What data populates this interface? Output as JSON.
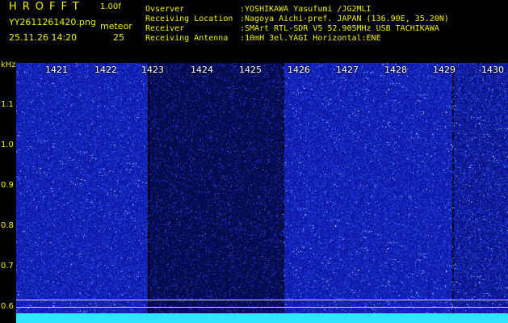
{
  "header": {
    "app_title": "HROFFT",
    "version": "1.00f",
    "filename": "YY2611261420.png",
    "timestamp": "25.11.26 14:20",
    "detection_label": "meteor",
    "detection_count": "25"
  },
  "station": [
    {
      "label": "Ovserver",
      "value": ":YOSHIKAWA Yasufumi /JG2MLI"
    },
    {
      "label": "Receiving Location",
      "value": ":Nagoya Aichi-pref. JAPAN (136.90E, 35.20N)"
    },
    {
      "label": "Receiver",
      "value": ":SMArt RTL-SDR V5 52.905MHz USB TACHIKAWA"
    },
    {
      "label": "Receiving Antenna",
      "value": ":10mH 3el.YAGI Horizontal:ENE"
    }
  ],
  "axis": {
    "unit": "kHz",
    "y_ticks": [
      "1.1",
      "1.0",
      "0.9",
      "0.8",
      "0.7",
      "0.6"
    ],
    "x_ticks": [
      "1421",
      "1422",
      "1423",
      "1424",
      "1425",
      "1426",
      "1427",
      "1428",
      "1429",
      "1430"
    ]
  },
  "colors": {
    "background": "#000000",
    "text": "#f0f000",
    "noise_base": "#0e1aa8",
    "noise_dim": "#060c50",
    "floor": "#2ee6ff"
  }
}
